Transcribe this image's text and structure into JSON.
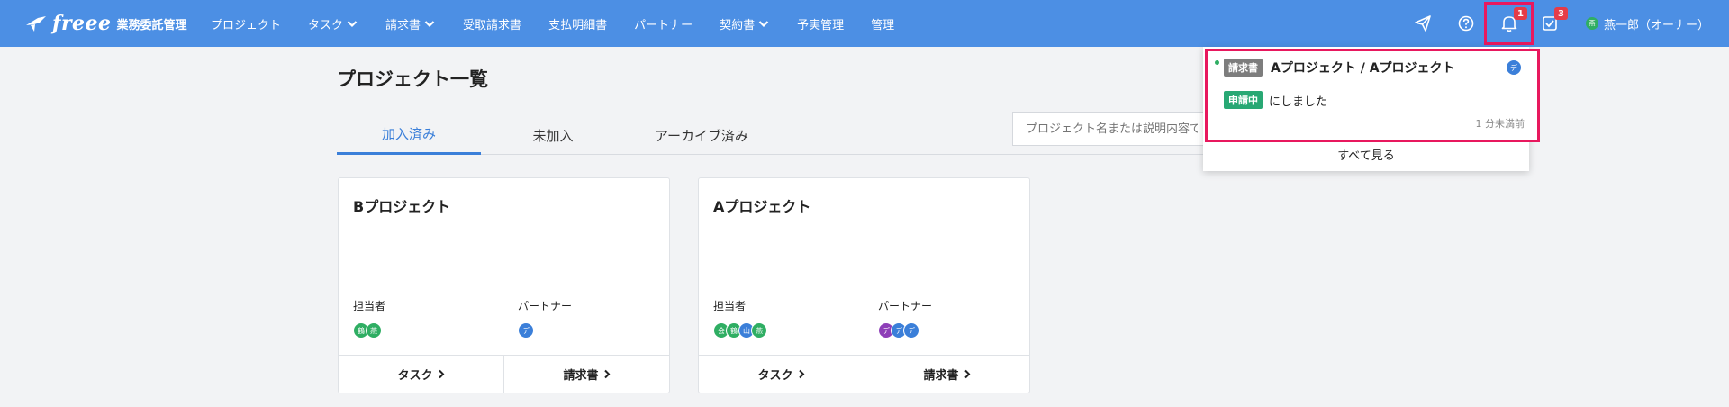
{
  "header": {
    "logo": "freee",
    "product": "業務委託管理",
    "nav": [
      {
        "label": "プロジェクト",
        "dropdown": false
      },
      {
        "label": "タスク",
        "dropdown": true
      },
      {
        "label": "請求書",
        "dropdown": true
      },
      {
        "label": "受取請求書",
        "dropdown": false
      },
      {
        "label": "支払明細書",
        "dropdown": false
      },
      {
        "label": "パートナー",
        "dropdown": false
      },
      {
        "label": "契約書",
        "dropdown": true
      },
      {
        "label": "予実管理",
        "dropdown": false
      },
      {
        "label": "管理",
        "dropdown": false
      }
    ],
    "icons": {
      "send": "paper-plane-icon",
      "help": "question-circle-icon",
      "bell": "bell-icon",
      "tasks": "checkbox-icon"
    },
    "notification_count": "1",
    "task_count": "3",
    "user": {
      "avatar": "燕",
      "name": "燕一郎（オーナー）"
    }
  },
  "page": {
    "title": "プロジェクト一覧",
    "tabs": [
      "加入済み",
      "未加入",
      "アーカイブ済み"
    ],
    "active_tab": 0,
    "search_placeholder": "プロジェクト名または説明内容で"
  },
  "projects": [
    {
      "name": "Bプロジェクト",
      "assignee_label": "担当者",
      "partner_label": "パートナー",
      "assignees": [
        {
          "initial": "鶴",
          "color": "#2fae63"
        },
        {
          "initial": "燕",
          "color": "#2fae63"
        }
      ],
      "partners": [
        {
          "initial": "デ",
          "color": "#3b7fd9"
        }
      ],
      "task_button": "タスク",
      "invoice_button": "請求書"
    },
    {
      "name": "Aプロジェクト",
      "assignee_label": "担当者",
      "partner_label": "パートナー",
      "assignees": [
        {
          "initial": "会",
          "color": "#2fae63"
        },
        {
          "initial": "鶴",
          "color": "#2fae63"
        },
        {
          "initial": "山",
          "color": "#3b7fd9"
        },
        {
          "initial": "燕",
          "color": "#2fae63"
        }
      ],
      "partners": [
        {
          "initial": "デ",
          "color": "#8e3fb8"
        },
        {
          "initial": "デ",
          "color": "#3b7fd9"
        },
        {
          "initial": "デ",
          "color": "#3b7fd9"
        }
      ],
      "task_button": "タスク",
      "invoice_button": "請求書"
    }
  ],
  "notifications": {
    "items": [
      {
        "tag": "請求書",
        "title": "Aプロジェクト / Aプロジェクト",
        "avatar": "デ",
        "status": "申請中",
        "message": "にしました",
        "time": "1 分未満前"
      }
    ],
    "see_all": "すべて見る"
  },
  "colors": {
    "header_bg": "#4c8fe4",
    "accent": "#3b7fd9",
    "highlight": "#e8185e",
    "badge": "#e53c48",
    "status_green": "#28a874"
  }
}
